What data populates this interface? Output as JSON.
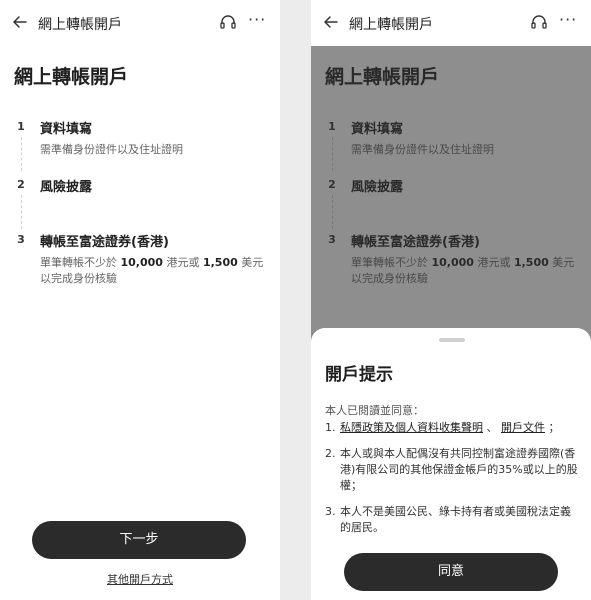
{
  "nav": {
    "title": "網上轉帳開戶",
    "back_icon": "back-arrow-icon",
    "support_icon": "headset-icon",
    "more_label": "···"
  },
  "page_title": "網上轉帳開戶",
  "steps": [
    {
      "number": "1",
      "title": "資料填寫",
      "desc": "需準備身份證件以及住址證明"
    },
    {
      "number": "2",
      "title": "風險披露",
      "desc": ""
    },
    {
      "number": "3",
      "title": "轉帳至富途證券(香港)",
      "desc_pre": "單筆轉帳不少於 ",
      "amount_hkd": "10,000",
      "desc_mid1": " 港元或 ",
      "amount_usd": "1,500",
      "desc_mid2": " 美元",
      "desc_end": "以完成身份核驗"
    }
  ],
  "next_button": "下一步",
  "other_methods_link": "其他開戶方式",
  "sheet": {
    "title": "開戶提示",
    "intro": "本人已閱讀並同意：",
    "terms": [
      {
        "number": "1.",
        "link1": "私隱政策及個人資料收集聲明",
        "sep": " 、 ",
        "link2": "開戶文件",
        "end": " ；"
      },
      {
        "number": "2.",
        "text": "本人或與本人配偶沒有共同控制富途證券國際(香港)有限公司的其他保證金帳戶的35%或以上的股權；"
      },
      {
        "number": "3.",
        "text": "本人不是美國公民、綠卡持有者或美國稅法定義的居民。"
      }
    ],
    "agree_button": "同意"
  }
}
